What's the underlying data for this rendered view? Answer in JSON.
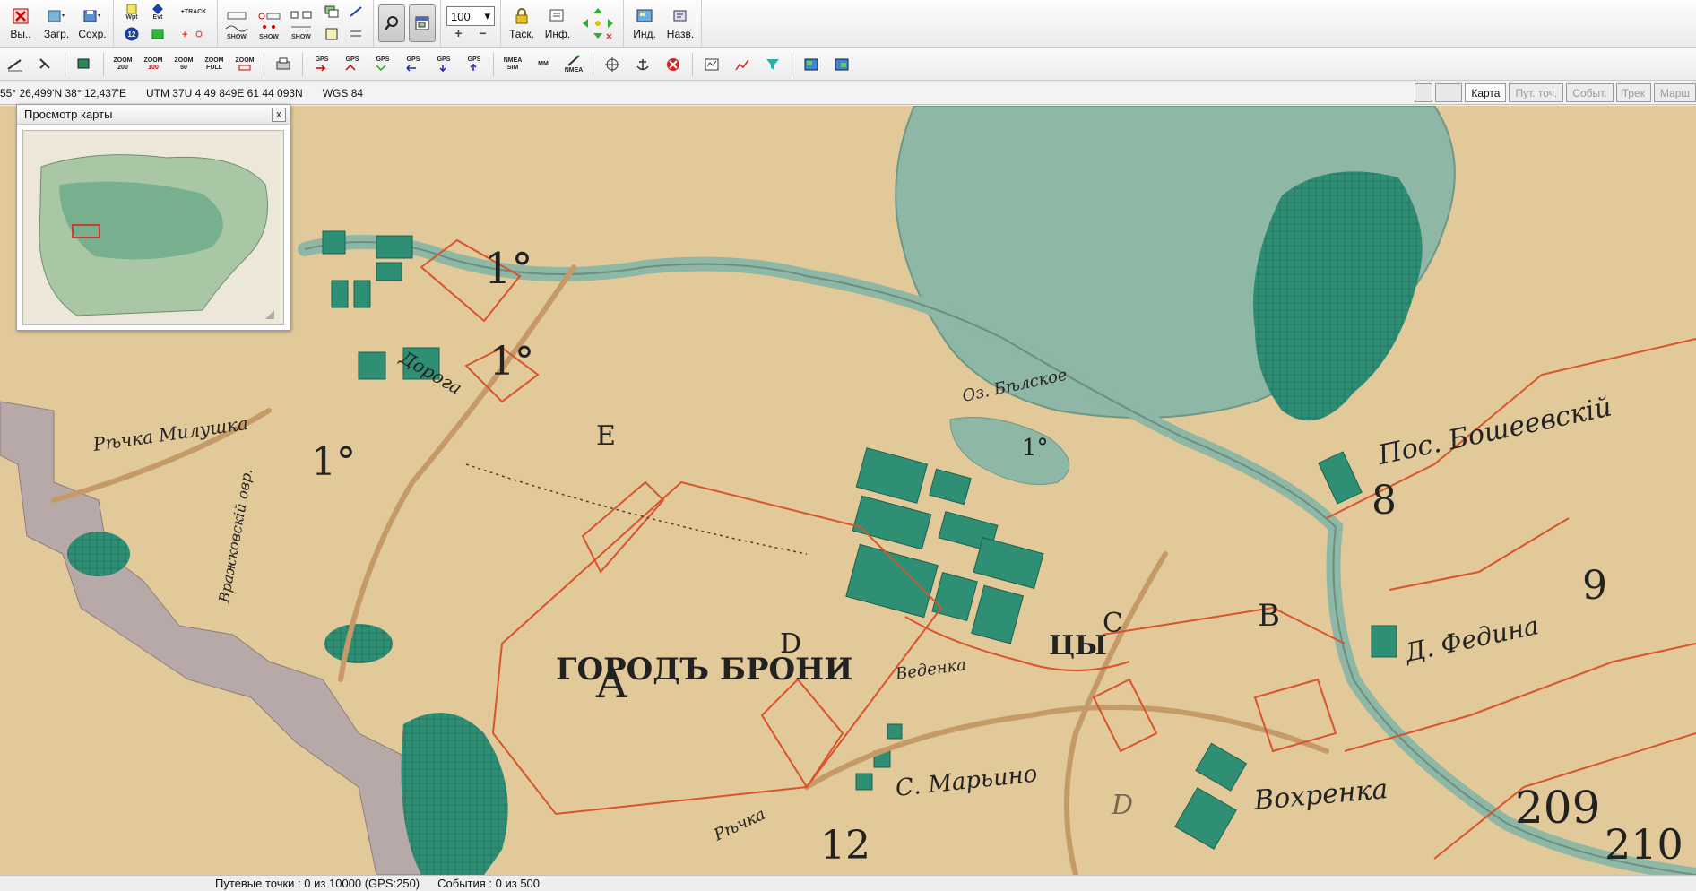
{
  "toolbar": {
    "exit": "Вы..",
    "load": "Загр.",
    "save": "Сохр.",
    "wpt": "Wpt",
    "evt": "Evt",
    "badge": "12",
    "track": "+TRACK",
    "show1": "SHOW",
    "show2": "SHOW",
    "show3": "SHOW",
    "line": "LINE",
    "zoom_value": "100",
    "zoom_plus": "+",
    "zoom_minus": "−",
    "drag": "Таск.",
    "info": "Инф.",
    "ind": "Инд.",
    "names": "Назв."
  },
  "toolbar2": {
    "zoom200": "ZOOM",
    "zoom200_v": "200",
    "zoom100": "ZOOM",
    "zoom100_v": "100",
    "zoom50": "ZOOM",
    "zoom50_v": "50",
    "zoomfull": "ZOOM",
    "zoomfull_v": "FULL",
    "zoom": "ZOOM",
    "gps1": "GPS",
    "gps2": "GPS",
    "gps3": "GPS",
    "gps4": "GPS",
    "gps5": "GPS",
    "gps6": "GPS",
    "nmea_sim": "NMEA SIM",
    "mm_a": "MM",
    "nmea": "NMEA"
  },
  "coords": {
    "latlon": "55° 26,499'N  38° 12,437'E",
    "utm": "UTM  37U   4 49 849E    61 44 093N",
    "datum": "WGS 84"
  },
  "modetabs": [
    "Карта",
    "Пут. точ.",
    "Событ.",
    "Трек",
    "Марш"
  ],
  "overview": {
    "title": "Просмотр карты",
    "close": "x"
  },
  "map_labels": {
    "city": "ГОРОДЪ БРОНИЦЫ",
    "city_a": "ГОРОДЪ БРОНИ",
    "city_b": "ЦЫ",
    "lake": "Оз. Бѣлское",
    "river_mil": "Рѣчка Милушка",
    "road": "Дорога",
    "ovrag": "Вражковскiй овр.",
    "river_vedenka": "Веденка",
    "rechka": "Рѣчка",
    "posad": "Пос. Бошеевскiй",
    "fedina": "Д. Федина",
    "marchino": "С. Марьино",
    "vohrenka": "Вохренка",
    "letters": [
      "A",
      "B",
      "C",
      "D",
      "E",
      "1°",
      "1°",
      "1°",
      "1°",
      "8",
      "9",
      "12",
      "209",
      "210",
      "D"
    ]
  },
  "colors": {
    "parchment": "#e2c99a",
    "water": "#8fb7a5",
    "forest": "#2f8f74",
    "red_line": "#d9532b",
    "road": "#c69a68"
  },
  "status": {
    "waypoints": "Путевые точки : 0 из 10000  (GPS:250)",
    "events": "События : 0 из 500"
  }
}
